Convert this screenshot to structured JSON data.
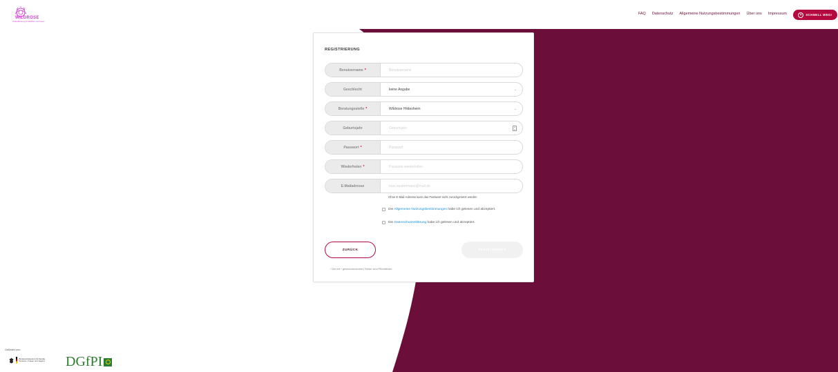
{
  "brand": {
    "logo_text": "WILDROSE",
    "logo_sub": "Online-Beratung für Mädchen und Frauen",
    "accent": "#b3093f",
    "wine": "#6b0f3a",
    "logo_pink": "#d13bd1"
  },
  "nav": {
    "items": [
      "FAQ",
      "Datenschutz",
      "Allgemeine Nutzungsbestimmungen",
      "Über uns",
      "Impressum"
    ],
    "quick_exit_label": "SCHNELL WEG!",
    "quick_exit_icon": "close-circle-icon"
  },
  "form": {
    "title": "REGISTRIERUNG",
    "fields": [
      {
        "label": "Benutzername",
        "required": "*",
        "value": "",
        "placeholder": "Benutzername",
        "type": "text"
      },
      {
        "label": "Geschlecht",
        "required": "",
        "value": "keine Angabe",
        "placeholder": "",
        "type": "select"
      },
      {
        "label": "Beratungsstelle",
        "required": "*",
        "value": "Wildrose Hildesheim",
        "placeholder": "",
        "type": "select"
      },
      {
        "label": "Geburtsjahr",
        "required": "",
        "value": "",
        "placeholder": "Geburtsjahr",
        "type": "number"
      },
      {
        "label": "Passwort",
        "required": "*",
        "value": "",
        "placeholder": "Passwort",
        "type": "password"
      },
      {
        "label": "Wiederholen",
        "required": "*",
        "value": "",
        "placeholder": "Passwort wiederholen",
        "type": "password"
      },
      {
        "label": "E-Mailadresse",
        "required": "",
        "value": "",
        "placeholder": "max.mustermann@mail.de",
        "type": "email"
      }
    ],
    "email_note": "Ohne E-Mail-Adresse kann das Passwort nicht zurückgesetzt werden",
    "consent_terms": {
      "pre": "Die ",
      "link": "Allgemeine Nutzungsbestimmungen",
      "post": " habe ich gelesen und akzeptiert."
    },
    "consent_privacy": {
      "pre": "Die ",
      "link": "Datenschutzerklärung",
      "post": " habe ich gelesen und akzeptiert."
    },
    "back_label": "ZURÜCK",
    "register_label": "REGISTRIEREN",
    "required_note": "* Die mit * gekennzeichneten Felder sind Pflichtfelder"
  },
  "footer": {
    "funded_by": "Gefördert vom",
    "ministry": "Bundesministerium für Familie, Senioren, Frauen und Jugend",
    "partner": "DGfPI"
  }
}
